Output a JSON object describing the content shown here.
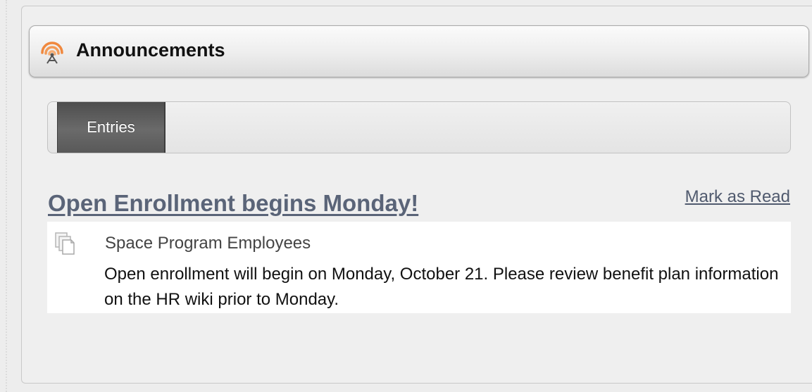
{
  "portlet": {
    "title": "Announcements",
    "icon": "broadcast-icon"
  },
  "tabs": [
    {
      "label": "Entries",
      "active": true
    }
  ],
  "entry": {
    "title": "Open Enrollment begins Monday!",
    "mark_read_label": "Mark as Read",
    "scope": "Space Program Employees",
    "content": "Open enrollment will begin on Monday, October 21.  Please review benefit plan information on the HR wiki prior to Monday.",
    "icon": "documents-icon"
  },
  "colors": {
    "title_link": "#5a6478",
    "tab_active_bg": "#595959",
    "icon_accent": "#f0883e"
  }
}
